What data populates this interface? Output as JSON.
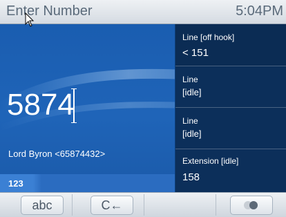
{
  "titlebar": {
    "title": "Enter Number",
    "clock": "5:04PM"
  },
  "dial": {
    "number": "5874",
    "contact": "Lord Byron <65874432>",
    "mode": "123"
  },
  "lines": [
    {
      "label": "Line [off hook]",
      "value": "< 151"
    },
    {
      "label": "Line",
      "value": "[idle]"
    },
    {
      "label": "Line",
      "value": "[idle]"
    },
    {
      "label": "Extension [idle]",
      "value": "158"
    }
  ],
  "softkeys": {
    "abc": "abc",
    "backspace": "C"
  },
  "icons": {
    "backspace": "left-arrow-icon",
    "toggle": "toggle-dots-icon",
    "cursor": "mouse-pointer-icon"
  },
  "colors": {
    "dial_bg": "#1f64b8",
    "panel_bg": "#0c2f5a",
    "bar_bg": "#d5dbe2"
  }
}
